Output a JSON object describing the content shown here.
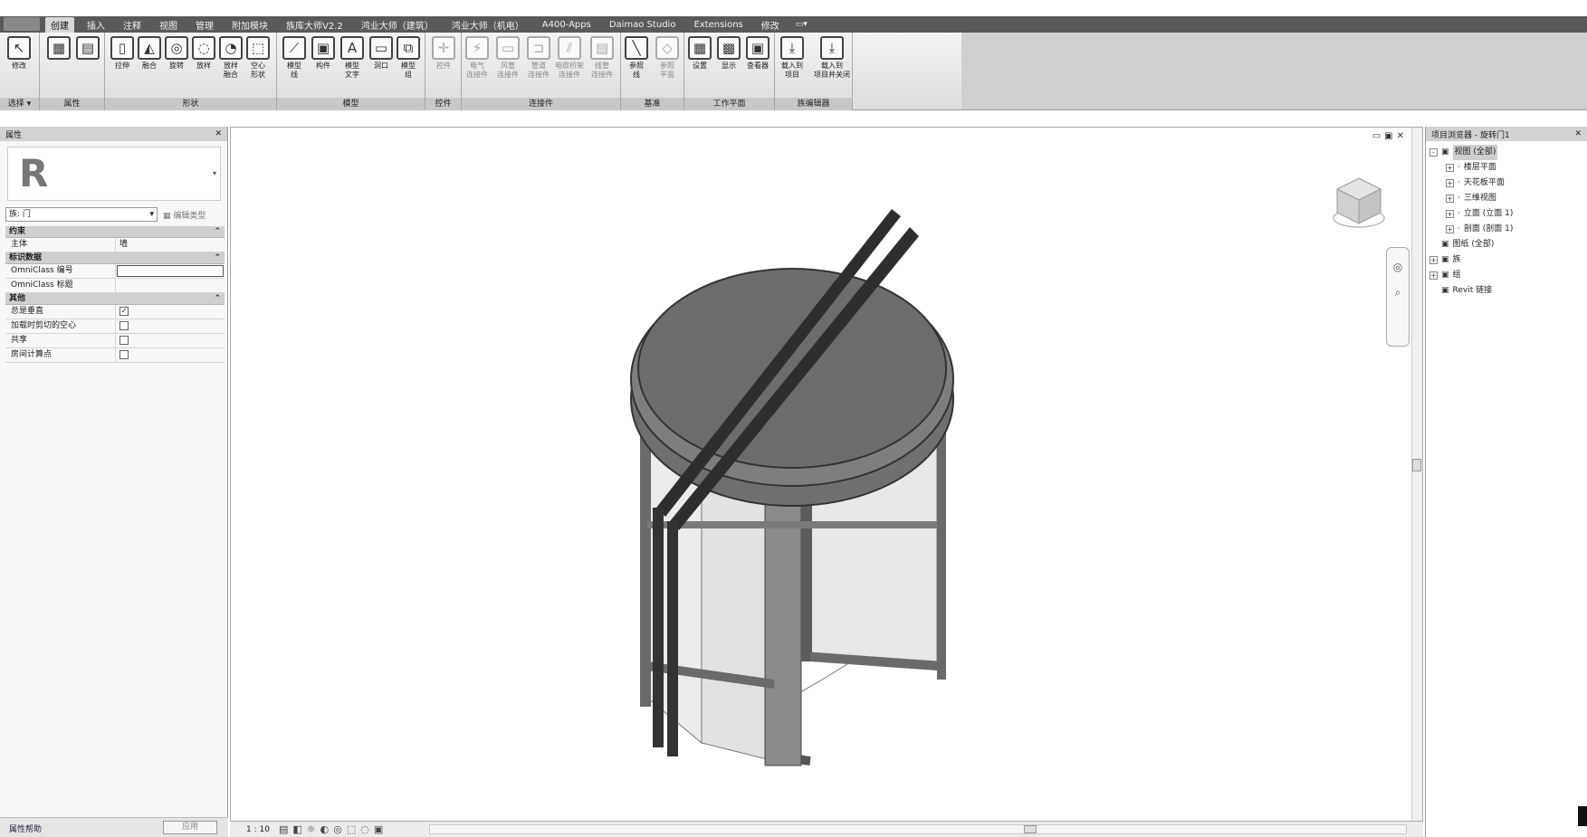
{
  "tabs": [
    "创建",
    "插入",
    "注释",
    "视图",
    "管理",
    "附加模块",
    "族库大师V2.2",
    "鸿业大师（建筑）",
    "鸿业大师（机电）",
    "A400-Apps",
    "Daimao Studio",
    "Extensions",
    "修改"
  ],
  "active_tab": "创建",
  "ribbon": {
    "modify_label": "修改",
    "select_label": "选择 ▾",
    "panels": {
      "properties": "属性",
      "forms": "形状",
      "model": "模型",
      "control": "控件",
      "connectors": "连接件",
      "datum": "基准",
      "workplane": "工作平面",
      "family_editor": "族编辑器"
    },
    "tools": {
      "extrusion": "拉伸",
      "blend": "融合",
      "revolve": "旋转",
      "sweep": "放样",
      "swept_blend": "放样\n融合",
      "void": "空心\n形状",
      "model_line": "模型\n线",
      "component": "构件",
      "model_text": "模型\n文字",
      "opening": "洞口",
      "model_group": "模型\n组",
      "control": "控件",
      "electrical": "电气\n连接件",
      "duct": "风管\n连接件",
      "pipe": "管道\n连接件",
      "cable_tray": "电缆桥架\n连接件",
      "conduit": "线管\n连接件",
      "ref_line": "参照\n线",
      "ref_plane": "参照\n平面",
      "set": "设置",
      "show": "显示",
      "viewer": "查看器",
      "load_into_project": "载入到\n项目",
      "load_close": "载入到\n项目并关闭"
    }
  },
  "properties": {
    "header": "属性",
    "type_value": "族: 门",
    "edit_type": "编辑类型",
    "sections": [
      {
        "title": "约束",
        "rows": [
          {
            "k": "主体",
            "v": "墙"
          }
        ]
      },
      {
        "title": "标识数据",
        "rows": [
          {
            "k": "OmniClass 编号",
            "v": "",
            "input": true
          },
          {
            "k": "OmniClass 标题",
            "v": ""
          }
        ]
      },
      {
        "title": "其他",
        "rows": [
          {
            "k": "总是垂直",
            "checked": true
          },
          {
            "k": "加载时剪切的空心",
            "checked": false
          },
          {
            "k": "共享",
            "checked": false
          },
          {
            "k": "房间计算点",
            "checked": false
          }
        ]
      }
    ],
    "help": "属性帮助",
    "apply": "应用"
  },
  "viewbar": {
    "scale": "1 : 10"
  },
  "browser": {
    "header": "项目浏览器 - 旋转门1",
    "tree": [
      {
        "label": "视图 (全部)",
        "level": 0,
        "sel": true,
        "exp": "-"
      },
      {
        "label": "楼层平面",
        "level": 1,
        "exp": "+"
      },
      {
        "label": "天花板平面",
        "level": 1,
        "exp": "+"
      },
      {
        "label": "三维视图",
        "level": 1,
        "exp": "+"
      },
      {
        "label": "立面 (立面 1)",
        "level": 1,
        "exp": "+"
      },
      {
        "label": "剖面 (剖面 1)",
        "level": 1,
        "exp": "+"
      },
      {
        "label": "图纸 (全部)",
        "level": 0,
        "exp": ""
      },
      {
        "label": "族",
        "level": 0,
        "exp": "+"
      },
      {
        "label": "组",
        "level": 0,
        "exp": "+"
      },
      {
        "label": "Revit 链接",
        "level": 0,
        "exp": ""
      }
    ]
  }
}
